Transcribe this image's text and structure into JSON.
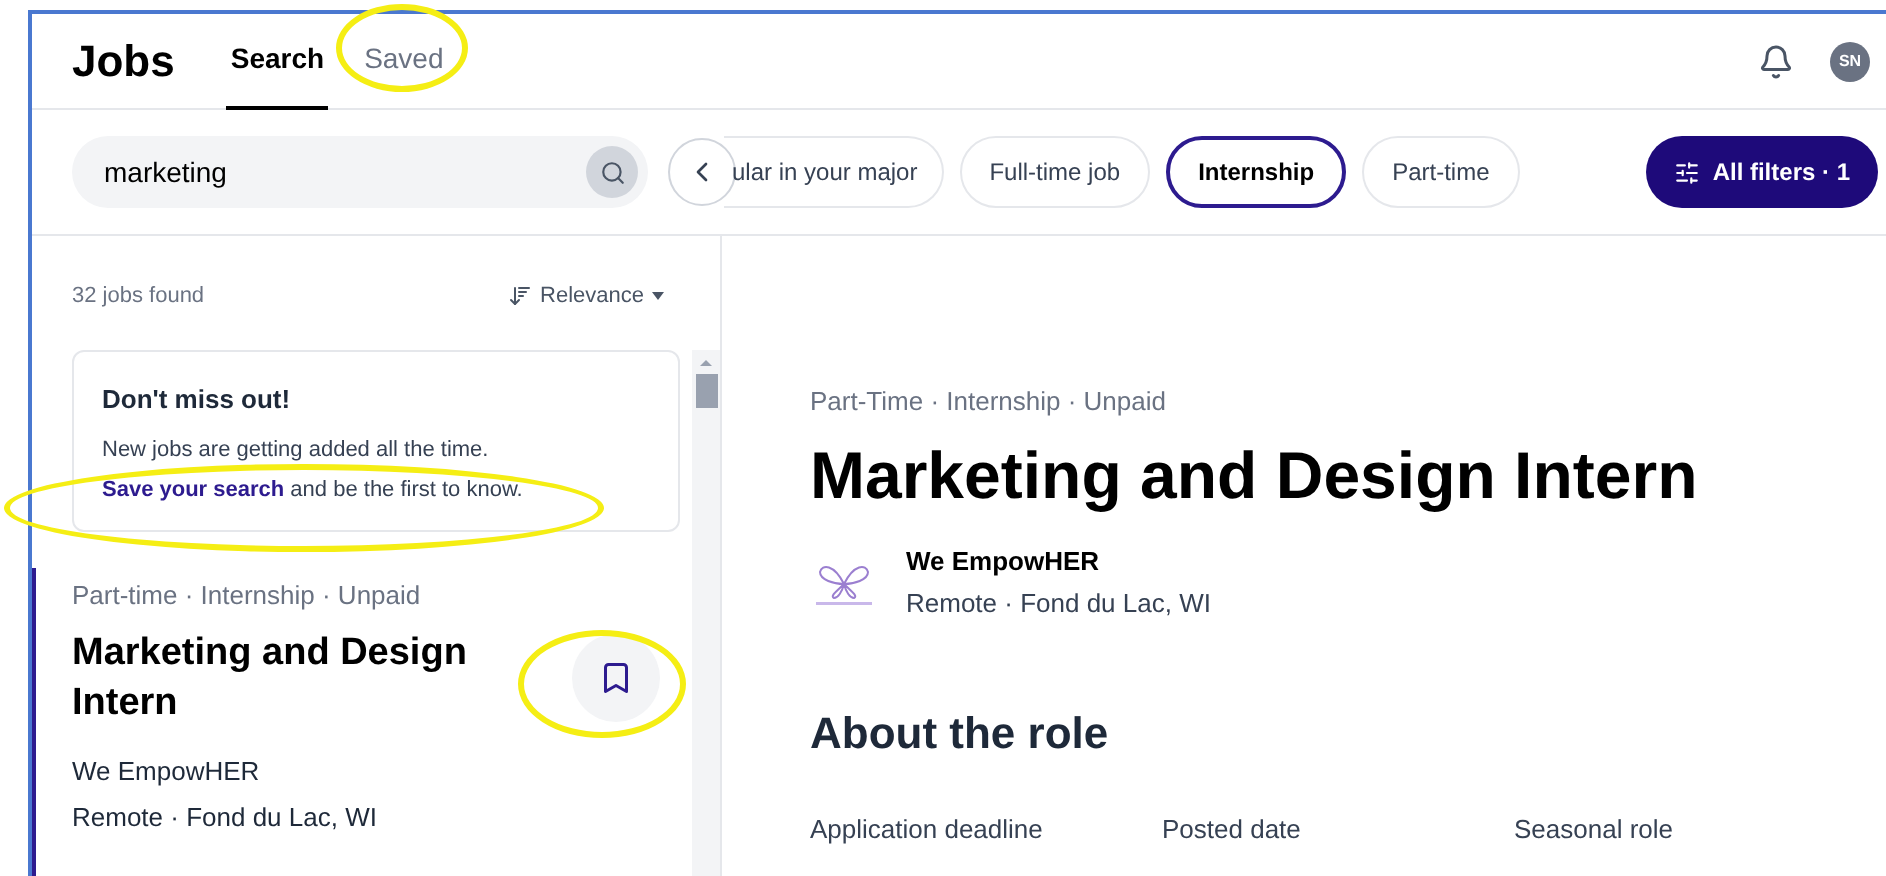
{
  "header": {
    "title": "Jobs",
    "tabs": [
      {
        "label": "Search",
        "selected": true
      },
      {
        "label": "Saved",
        "selected": false
      }
    ],
    "avatar": "SN"
  },
  "search": {
    "value": "marketing"
  },
  "chips": [
    {
      "label": "ular in your major",
      "selected": false,
      "kind": "faded"
    },
    {
      "label": "Full-time job",
      "selected": false,
      "kind": "chip"
    },
    {
      "label": "Internship",
      "selected": true,
      "kind": "chip"
    },
    {
      "label": "Part-time",
      "selected": false,
      "kind": "chip"
    }
  ],
  "all_filters": "All filters · 1",
  "results": {
    "count": "32 jobs found",
    "sort": "Relevance"
  },
  "promo": {
    "title": "Don't miss out!",
    "line": "New jobs are getting added all the time.",
    "link": "Save your search",
    "rest": " and be the first to know."
  },
  "job_card": {
    "meta": "Part-time · Internship · Unpaid",
    "title": "Marketing and Design Intern",
    "company": "We EmpowHER",
    "location": "Remote · Fond du Lac, WI",
    "selected": true,
    "saved": false
  },
  "detail": {
    "meta": "Part-Time · Internship · Unpaid",
    "title": "Marketing and Design Intern",
    "company": "We EmpowHER",
    "location": "Remote · Fond du Lac, WI",
    "section": "About the role",
    "fields": [
      "Application deadline",
      "Posted date",
      "Seasonal role"
    ]
  }
}
